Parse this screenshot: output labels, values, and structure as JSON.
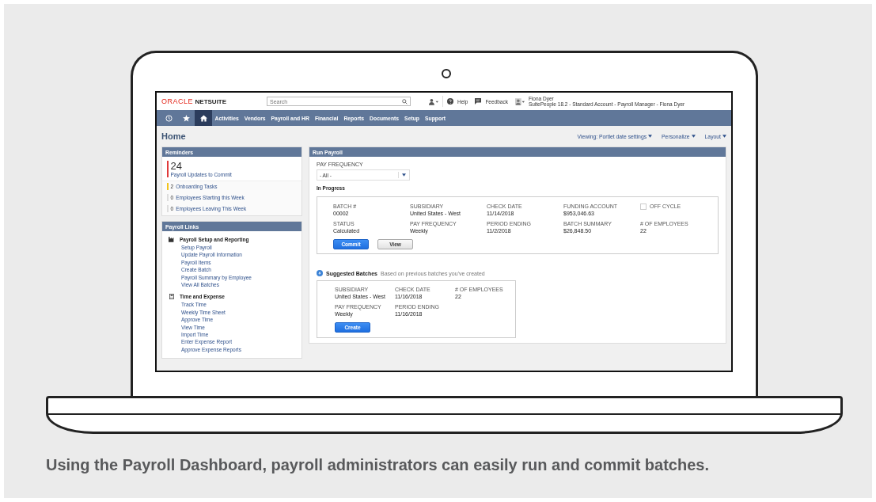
{
  "header": {
    "logo": {
      "brand": "ORACLE",
      "product": "NETSUITE"
    },
    "search": {
      "placeholder": "Search"
    },
    "help": "Help",
    "feedback": "Feedback",
    "user": {
      "name": "Fiona Dyer",
      "account": "SuitePeople 18.2 - Standard Account - Payroll Manager - Fiona Dyer"
    }
  },
  "nav": {
    "icons": [
      {
        "kind": "recent",
        "selected": false
      },
      {
        "kind": "star",
        "selected": false
      },
      {
        "kind": "home",
        "selected": true
      }
    ],
    "items": [
      "Activities",
      "Vendors",
      "Payroll and HR",
      "Financial",
      "Reports",
      "Documents",
      "Setup",
      "Support"
    ]
  },
  "page": {
    "title": "Home",
    "actions": [
      "Viewing: Portlet date settings",
      "Personalize",
      "Layout"
    ]
  },
  "reminders": {
    "title": "Reminders",
    "featured": {
      "count": "24",
      "label": "Payroll Updates to Commit",
      "color": "#e03a3a"
    },
    "items": [
      {
        "count": "2",
        "label": "Onboarding Tasks",
        "color": "#f2c31a"
      },
      {
        "count": "0",
        "label": "Employees Starting this Week",
        "color": "#dddddd"
      },
      {
        "count": "0",
        "label": "Employees Leaving This Week",
        "color": "#dddddd"
      }
    ]
  },
  "payroll_links": {
    "title": "Payroll Links",
    "sections": [
      {
        "kind": "factory",
        "heading": "Payroll Setup and Reporting",
        "links": [
          "Setup Payroll",
          "Update Payroll Information",
          "Payroll Items",
          "Create Batch",
          "Payroll Summary by Employee",
          "View All Batches"
        ]
      },
      {
        "kind": "calculator",
        "heading": "Time and Expense",
        "links": [
          "Track Time",
          "Weekly Time Sheet",
          "Approve Time",
          "View Time",
          "Import Time",
          "Enter Expense Report",
          "Approve Expense Reports"
        ]
      }
    ]
  },
  "run_payroll": {
    "title": "Run Payroll",
    "filter": {
      "label": "PAY FREQUENCY",
      "value": "- All -"
    },
    "section": "In Progress",
    "batch": {
      "fields": [
        {
          "kind": "value",
          "label": "BATCH #",
          "value": "00002"
        },
        {
          "kind": "value",
          "label": "SUBSIDIARY",
          "value": "United States - West"
        },
        {
          "kind": "value",
          "label": "CHECK DATE",
          "value": "11/14/2018"
        },
        {
          "kind": "value",
          "label": "FUNDING ACCOUNT",
          "value": "$953,046.63"
        },
        {
          "kind": "checkbox",
          "label": "OFF CYCLE",
          "checked": false
        },
        {
          "kind": "value",
          "label": "STATUS",
          "value": "Calculated"
        },
        {
          "kind": "value",
          "label": "PAY FREQUENCY",
          "value": "Weekly"
        },
        {
          "kind": "value",
          "label": "PERIOD ENDING",
          "value": "11/2/2018"
        },
        {
          "kind": "value",
          "label": "BATCH SUMMARY",
          "value": "$26,848.50"
        },
        {
          "kind": "value",
          "label": "# OF EMPLOYEES",
          "value": "22"
        }
      ],
      "buttons": [
        {
          "label": "Commit",
          "kind": "primary"
        },
        {
          "label": "View",
          "kind": "secondary"
        }
      ]
    },
    "suggested": {
      "title": "Suggested Batches",
      "note": "Based on previous batches you've created",
      "fields": [
        {
          "kind": "value",
          "label": "SUBSIDIARY",
          "value": "United States - West"
        },
        {
          "kind": "value",
          "label": "CHECK DATE",
          "value": "11/16/2018"
        },
        {
          "kind": "value",
          "label": "# OF EMPLOYEES",
          "value": "22"
        },
        {
          "kind": "value",
          "label": "PAY FREQUENCY",
          "value": "Weekly"
        },
        {
          "kind": "value",
          "label": "PERIOD ENDING",
          "value": "11/16/2018"
        }
      ],
      "buttons": [
        {
          "label": "Create",
          "kind": "primary"
        }
      ]
    }
  },
  "caption": "Using the Payroll Dashboard, payroll administrators can easily run and commit batches."
}
